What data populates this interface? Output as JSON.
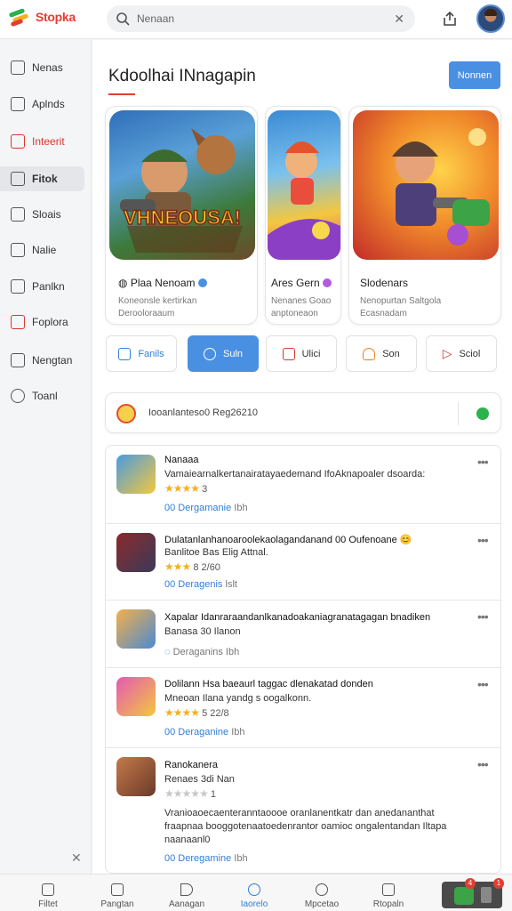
{
  "app": {
    "logo_text": "Stopka"
  },
  "colors": {
    "accent": "#4a90e2",
    "brand": "#e33d2f",
    "star": "#f5b01c"
  },
  "search": {
    "value": "Nenaan",
    "placeholder": "Nenaan",
    "clear_icon": "x-icon"
  },
  "sidebar": {
    "items": [
      {
        "label": "Nenas",
        "icon": "home-icon"
      },
      {
        "label": "Aplnds",
        "icon": "apps-icon"
      },
      {
        "label": "Inteerit",
        "icon": "calendar-icon"
      },
      {
        "label": "Fitok",
        "icon": "mail-icon"
      },
      {
        "label": "Sloais",
        "icon": "chat-icon"
      },
      {
        "label": "Nalie",
        "icon": "cart-icon"
      },
      {
        "label": "Panlkn",
        "icon": "grid-icon"
      },
      {
        "label": "Foplora",
        "icon": "store-icon"
      },
      {
        "label": "Nengtan",
        "icon": "book-icon"
      },
      {
        "label": "Toanl",
        "icon": "clock-icon"
      }
    ]
  },
  "main": {
    "title": "Kdoolhai INnagapin",
    "primary_button": "Nonnen"
  },
  "featured": [
    {
      "title": "Plaa Nenoam",
      "desc_1": "Koneonsle kertirkan",
      "desc_2": "Derooloraaum",
      "art_text": "VHNEOUSA!",
      "badge_color": "#4a90e2"
    },
    {
      "title": "Ares Gern",
      "desc_1": "Nenanes Goao",
      "desc_2": "anptoneaon",
      "badge_color": "#b25be0"
    },
    {
      "title": "Slodenars",
      "desc_1": "Nenopurtan Saltgola",
      "desc_2": "Ecasnadam"
    }
  ],
  "categories": [
    {
      "label": "Fanils",
      "icon": "folder-icon"
    },
    {
      "label": "Suln",
      "icon": "brush-icon"
    },
    {
      "label": "Ulici",
      "icon": "box-icon"
    },
    {
      "label": "Son",
      "icon": "headset-icon"
    },
    {
      "label": "Sciol",
      "icon": "play-icon"
    }
  ],
  "notice": {
    "text": "Iooanlanteso0 Reg26210",
    "go_icon": "chat-bubble-icon"
  },
  "feed": [
    {
      "title": "Nanaaa",
      "desc": "Vamaiearnalkertanairatayaedemand IfoAknapoaler dsoarda:",
      "desc_2": "",
      "stars": "★★★★",
      "rating": "3",
      "meta_link": "00  Dergamanie",
      "meta_tail": "Ibh"
    },
    {
      "title": "Dulatanlanhanoaroolekaolagandanand 00 Oufenoane 😊",
      "desc": "Banlitoe Bas Elig Attnal.",
      "desc_2": "",
      "stars": "★★★",
      "rating": "8  2/60",
      "meta_link": "00  Deragenis",
      "meta_tail": "lslt"
    },
    {
      "title": "Xapalar Idanraraandanlkanadoakaniagranatagagan bnadiken",
      "desc": "Banasa 30 Ilanon",
      "desc_2": "",
      "stars": "",
      "rating": "",
      "meta_link": "",
      "meta_tail": "Deraganins  Ibh"
    },
    {
      "title": "Dolilann Hsa baeaurl taggac dlenakatad donden",
      "desc": "Mneoan Ilana yandg s oogalkonn.",
      "desc_2": "",
      "stars": "★★★★",
      "rating": "5  22/8",
      "meta_link": "00  Deraganine",
      "meta_tail": "Ibh"
    },
    {
      "title": "Ranokanera",
      "desc": "Renaes 3di Nan",
      "desc_2": "",
      "stars": "★★★★★",
      "rating": "1",
      "meta_link": "00  Deregamine",
      "meta_tail": "Ibh",
      "body_1": "Vranioaoecaenteranntaoooe oranlanentkatr dan anedananthat",
      "body_2": "fraapnaa booggotenaatoedenrantor oamioc ongalentandan Iltapa",
      "body_3": "naanaanl0"
    }
  ],
  "bottom_nav": [
    {
      "label": "Filtet",
      "icon": "home-icon"
    },
    {
      "label": "Pangtan",
      "icon": "image-icon"
    },
    {
      "label": "Aanagan",
      "icon": "play-icon"
    },
    {
      "label": "Iaorelo",
      "icon": "globe-icon"
    },
    {
      "label": "Mpcetao",
      "icon": "settings-icon"
    },
    {
      "label": "Rtopaln",
      "icon": "mail-icon"
    }
  ],
  "widget": {
    "badge_left": "4",
    "badge_right": "1"
  }
}
